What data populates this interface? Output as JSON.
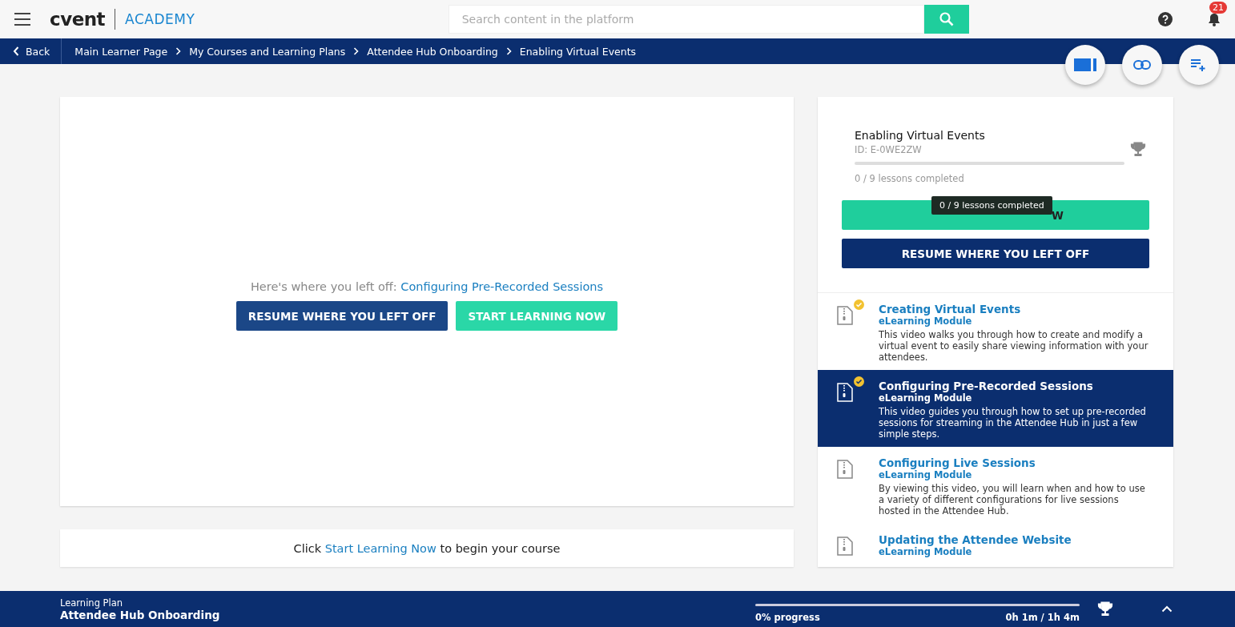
{
  "header": {
    "logo": "cvent",
    "logo_suffix": "ACADEMY",
    "search": {
      "placeholder": "Search content in the platform"
    },
    "notifications": "21"
  },
  "breadcrumb": {
    "back": "Back",
    "items": [
      "Main Learner Page",
      "My Courses and Learning Plans",
      "Attendee Hub Onboarding",
      "Enabling Virtual Events"
    ]
  },
  "main": {
    "prompt": "Here's where you left off:",
    "prompt_link": "Configuring Pre-Recorded Sessions",
    "buttons": [
      {
        "kind": "primary",
        "label": "RESUME WHERE YOU LEFT OFF"
      },
      {
        "kind": "accent",
        "label": "START LEARNING NOW"
      }
    ],
    "hint": {
      "before": "Click",
      "link": "Start Learning Now",
      "after": "to begin your course"
    }
  },
  "course": {
    "title": "Enabling Virtual Events",
    "id": "ID: E-0WE2ZW",
    "level": 0,
    "progress_text": "0 / 9 lessons completed",
    "tooltip": "0 / 9 lessons completed",
    "start_button_visible": "W",
    "resume_button": "RESUME WHERE YOU LEFT OFF",
    "lessons": [
      {
        "title": "Creating Virtual Events",
        "type": "eLearning Module",
        "description": "This video walks you through how to create and modify a virtual event to easily share viewing information with your attendees.",
        "completed": true,
        "selected": false
      },
      {
        "title": "Configuring Pre-Recorded Sessions",
        "type": "eLearning Module",
        "description": "This video guides you through how to set up pre-recorded sessions for streaming in the Attendee Hub in just a few simple steps.",
        "completed": true,
        "selected": true
      },
      {
        "title": "Configuring Live Sessions",
        "type": "eLearning Module",
        "description": "By viewing this video, you will learn when and how to use a variety of different configurations for live sessions hosted in the Attendee Hub.",
        "completed": false,
        "selected": false
      },
      {
        "title": "Updating the Attendee Website",
        "type": "eLearning Module",
        "completed": false,
        "selected": false
      }
    ]
  },
  "footer": {
    "label": "Learning Plan",
    "plan": "Attendee Hub Onboarding",
    "level": 0,
    "progress": "0% progress",
    "time": "0h 1m / 1h 4m"
  }
}
